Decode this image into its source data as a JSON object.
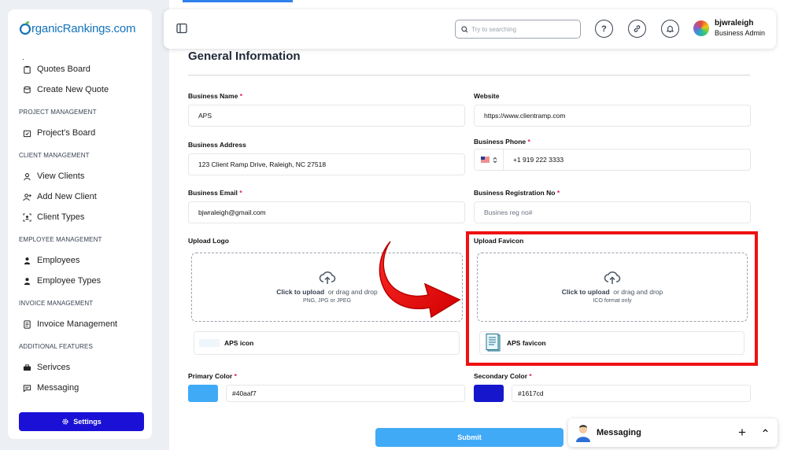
{
  "brand": {
    "logo_text": "rganicRankings.com"
  },
  "sidebar": {
    "top_items": [
      {
        "label": "Quotes Board",
        "icon": "clipboard-icon"
      },
      {
        "label": "Create New Quote",
        "icon": "database-icon"
      }
    ],
    "sections": {
      "project": "PROJECT MANAGEMENT",
      "client": "CLIENT MANAGEMENT",
      "employee": "EMPLOYEE MANAGEMENT",
      "invoice": "INVOICE MANAGEMENT",
      "additional": "ADDITIONAL FEATURES"
    },
    "items": {
      "projects_board": "Project's Board",
      "view_clients": "View Clients",
      "add_client": "Add New Client",
      "client_types": "Client Types",
      "employees": "Employees",
      "employee_types": "Employee Types",
      "invoice_management": "Invoice Management",
      "services": "Serivces",
      "messaging": "Messaging"
    },
    "settings_label": "Settings",
    "accent": "#1a10d6"
  },
  "header": {
    "search_placeholder": "Try to searching",
    "user_name": "bjwraleigh",
    "user_role": "Business Admin"
  },
  "form": {
    "title": "General Information",
    "business_name": {
      "label": "Business Name",
      "value": "APS"
    },
    "website": {
      "label": "Website",
      "value": "https://www.clientramp.com"
    },
    "business_address": {
      "label": "Business Address",
      "value": "123 Client Ramp Drive, Raleigh, NC 27518"
    },
    "business_phone": {
      "label": "Business Phone",
      "value": "+1 919 222 3333"
    },
    "business_email": {
      "label": "Business Email",
      "value": "bjwraleigh@gmail.com"
    },
    "registration_no": {
      "label": "Business Registration No",
      "placeholder": "Busines reg no#"
    },
    "upload_logo": {
      "label": "Upload Logo",
      "click_text": "Click to upload",
      "drag_text": "or drag and drop",
      "formats": "PNG, JPG or JPEG",
      "file_name": "APS icon"
    },
    "upload_favicon": {
      "label": "Upload Favicon",
      "click_text": "Click to upload",
      "drag_text": "or drag and drop",
      "formats": "ICO format only",
      "file_name": "APS favicon"
    },
    "primary_color": {
      "label": "Primary Color",
      "value": "#40aaf7"
    },
    "secondary_color": {
      "label": "Secondary Color",
      "value": "#1617cd"
    },
    "required_mark": "*",
    "submit_label": "Submit"
  },
  "messaging_widget": {
    "title": "Messaging"
  }
}
